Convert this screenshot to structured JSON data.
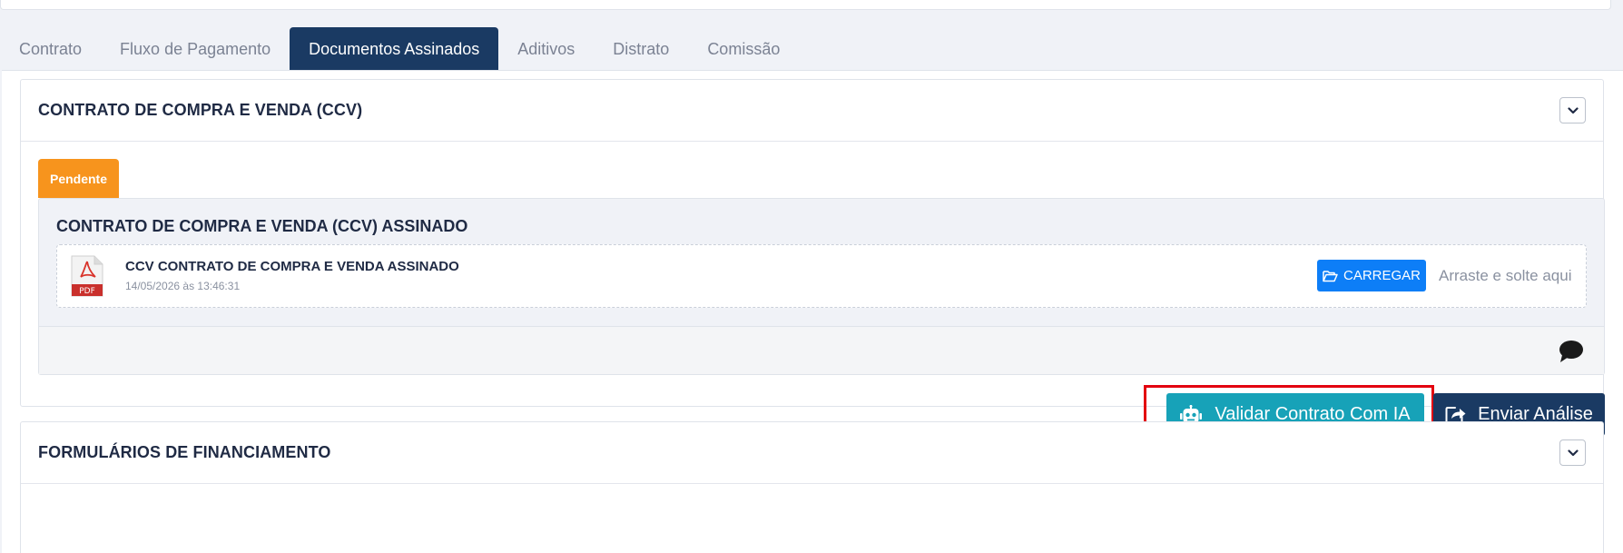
{
  "tabs": [
    {
      "label": "Contrato",
      "active": false
    },
    {
      "label": "Fluxo de Pagamento",
      "active": false
    },
    {
      "label": "Documentos Assinados",
      "active": true
    },
    {
      "label": "Aditivos",
      "active": false
    },
    {
      "label": "Distrato",
      "active": false
    },
    {
      "label": "Comissão",
      "active": false
    }
  ],
  "ccv_card": {
    "title": "CONTRATO DE COMPRA E VENDA (CCV)",
    "collapse_icon": "chevron-down-icon",
    "status_badge": "Pendente",
    "status_color": "#f7941d",
    "document_section_title": "CONTRATO DE COMPRA E VENDA (CCV) ASSINADO",
    "file": {
      "icon": "pdf-file-icon",
      "icon_label": "PDF",
      "name": "CCV CONTRATO DE COMPRA E VENDA ASSINADO",
      "date": "14/05/2026 às 13:46:31"
    },
    "upload_button": "CARREGAR",
    "upload_icon": "folder-open-icon",
    "drop_zone_text": "Arraste e solte aqui",
    "comment_icon": "chat-bubble-icon",
    "actions": {
      "validate_label": "Validar Contrato Com IA",
      "validate_icon": "robot-icon",
      "validate_color": "#17a2b8",
      "send_label": "Enviar Análise",
      "send_icon": "share-icon",
      "send_color": "#1a3a63"
    }
  },
  "financing_card": {
    "title": "FORMULÁRIOS DE FINANCIAMENTO",
    "collapse_icon": "chevron-down-icon"
  },
  "colors": {
    "primary_dark": "#1a3a63",
    "primary_blue": "#0d7ef7",
    "highlight": "#e3000f",
    "page_bg": "#f0f2f7"
  }
}
